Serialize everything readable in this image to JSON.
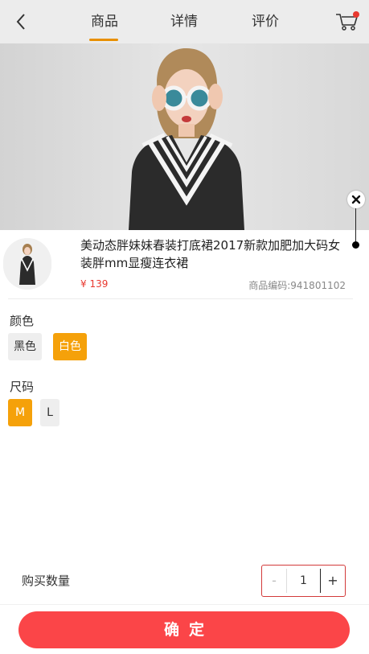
{
  "header": {
    "tabs": [
      {
        "label": "商品",
        "active": true
      },
      {
        "label": "详情",
        "active": false
      },
      {
        "label": "评价",
        "active": false
      }
    ],
    "back_icon": "chevron-left-icon",
    "cart_icon": "shopping-cart-icon",
    "accent_color": "#e89000"
  },
  "product": {
    "title": "美动态胖妹妹春装打底裙2017新款加肥加大码女装胖mm显瘦连衣裙",
    "price": "¥ 139",
    "sku": "商品编码:941801102",
    "price_color": "#e8382f"
  },
  "options": {
    "color": {
      "label": "颜色",
      "values": [
        "黑色",
        "白色"
      ],
      "selected": "白色"
    },
    "size": {
      "label": "尺码",
      "values": [
        "M",
        "L"
      ],
      "selected": "M"
    },
    "selected_color": "#f5a10a"
  },
  "quantity": {
    "label": "购买数量",
    "value": "1",
    "minus": "-",
    "plus": "+"
  },
  "confirm": {
    "label": "确定",
    "color": "#fb4548"
  }
}
